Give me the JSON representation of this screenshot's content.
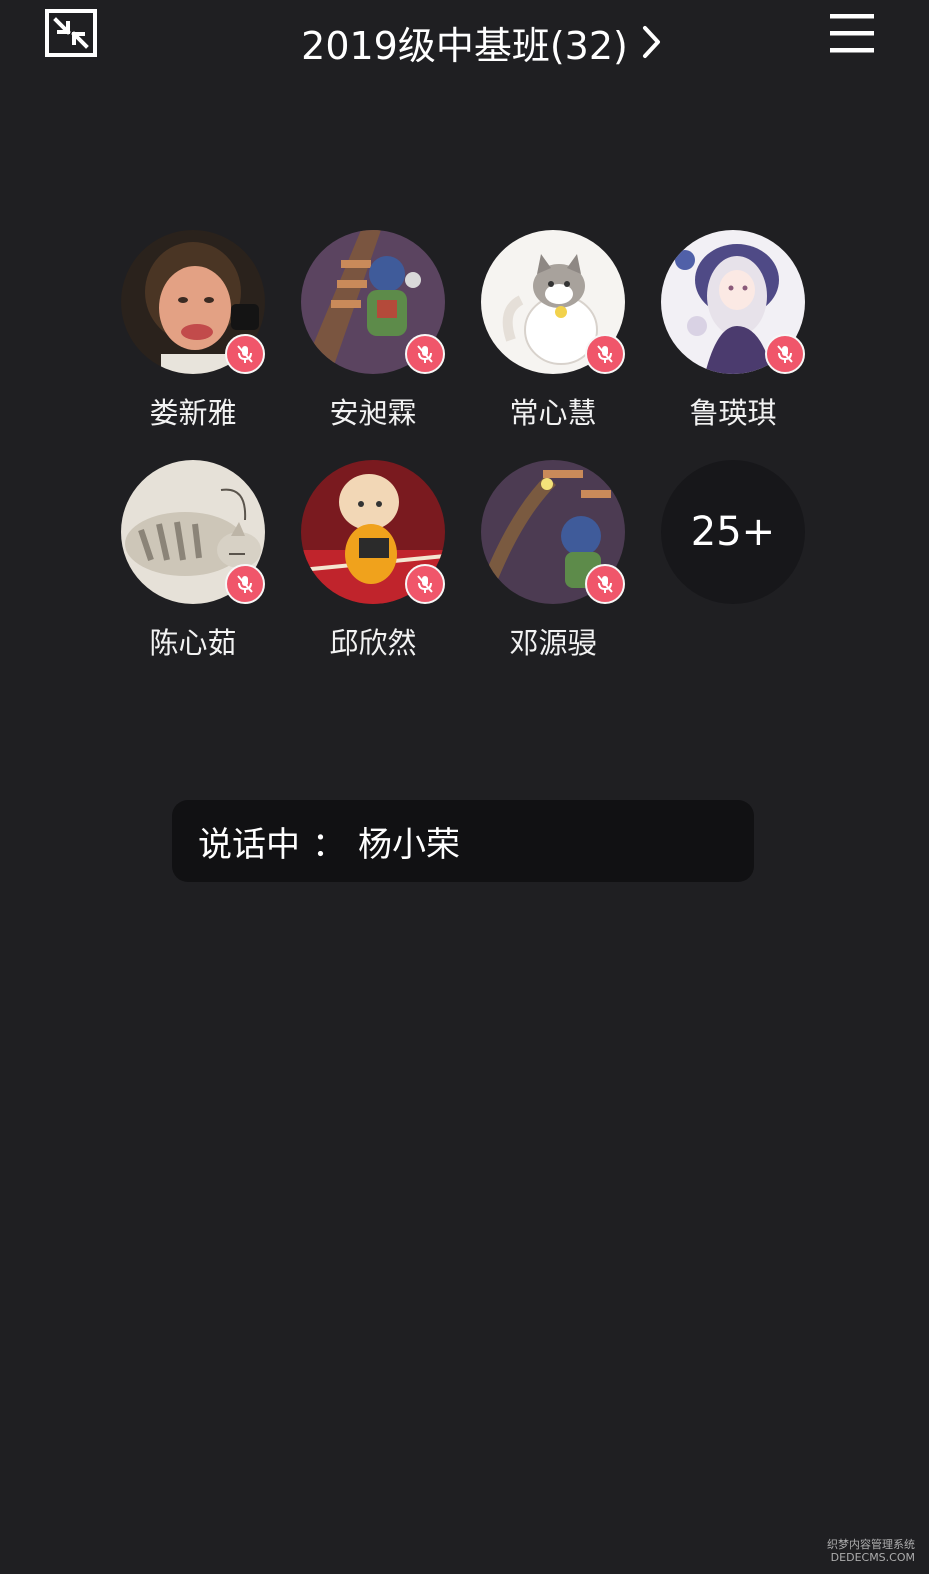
{
  "header": {
    "title": "2019级中基班(32)",
    "minimize_icon": "minimize-window-icon",
    "chevron_icon": "chevron-right-icon",
    "menu_icon": "hamburger-menu-icon"
  },
  "participants": [
    {
      "name": "娄新雅",
      "muted": true
    },
    {
      "name": "安昶霖",
      "muted": true
    },
    {
      "name": "常心慧",
      "muted": true
    },
    {
      "name": "鲁瑛琪",
      "muted": true
    },
    {
      "name": "陈心茹",
      "muted": true
    },
    {
      "name": "邱欣然",
      "muted": true
    },
    {
      "name": "邓源骎",
      "muted": true
    }
  ],
  "more": {
    "label": "25+"
  },
  "speaking": {
    "label": "说话中",
    "colon": "：",
    "name": "杨小荣"
  },
  "colors": {
    "background": "#1f1f22",
    "mute_badge": "#f0566a",
    "speaking_bar": "#111113"
  },
  "watermark": {
    "line1": "织梦内容管理系统",
    "line2": "DEDECMS.COM"
  }
}
